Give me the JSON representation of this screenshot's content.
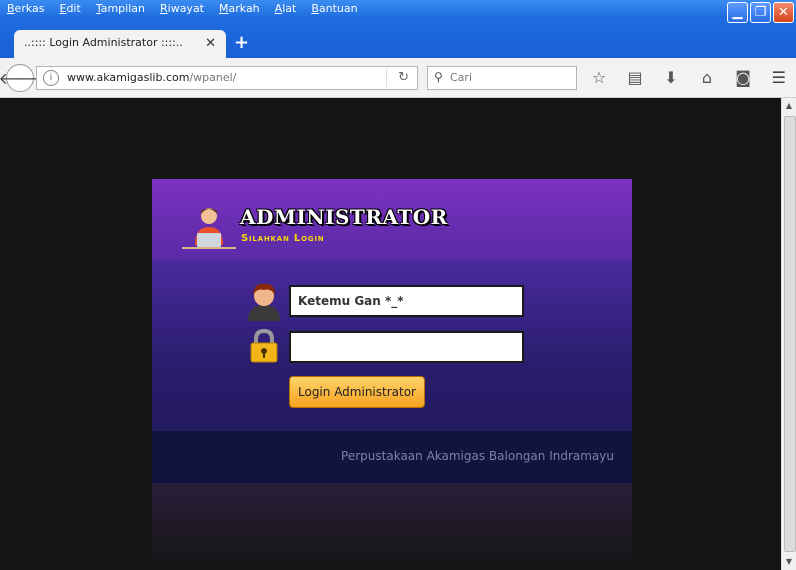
{
  "browser": {
    "menu": [
      "Berkas",
      "Edit",
      "Tampilan",
      "Riwayat",
      "Markah",
      "Alat",
      "Bantuan"
    ],
    "tab_title": "..:::: Login Administrator ::::..",
    "new_tab": "+",
    "url_main": "www.akamigaslib.com",
    "url_path": "/wpanel/",
    "search_placeholder": "Cari"
  },
  "panel": {
    "title": "ADMINISTRATOR",
    "subtitle": "Silahkan Login",
    "username_value": "Ketemu Gan *_*",
    "password_value": "",
    "login_button": "Login Administrator",
    "footer": "Perpustakaan Akamigas Balongan Indramayu"
  },
  "colors": {
    "header": "#6a2fb8",
    "body": "#2a1d6e",
    "footer": "#10143f",
    "button": "#f5a21f",
    "subtitle": "#f5d90a"
  }
}
